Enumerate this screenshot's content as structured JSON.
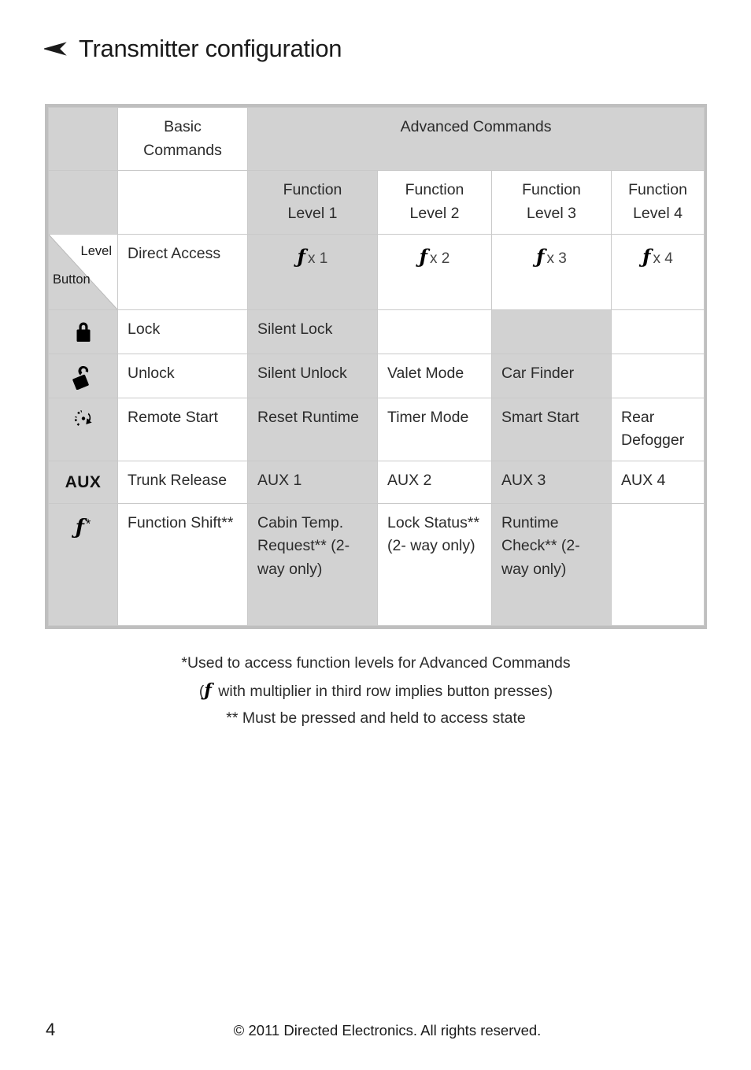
{
  "page": {
    "title": "Transmitter configuration",
    "bullet_icon": "arrow-bullet-icon"
  },
  "table": {
    "header": {
      "basic_commands": "Basic\nCommands",
      "basic_commands_line1": "Basic",
      "basic_commands_line2": "Commands",
      "advanced_commands": "Advanced Commands",
      "function_levels": [
        {
          "line1": "Function",
          "line2": "Level 1"
        },
        {
          "line1": "Function",
          "line2": "Level 2"
        },
        {
          "line1": "Function",
          "line2": "Level 3"
        },
        {
          "line1": "Function",
          "line2": "Level 4"
        }
      ],
      "corner": {
        "level_label": "Level",
        "button_label": "Button"
      },
      "direct_access": "Direct Access",
      "multipliers": [
        "x 1",
        "x 2",
        "x 3",
        "x 4"
      ],
      "f_symbol": "ƒ"
    },
    "rows": [
      {
        "icon": "lock-closed-icon",
        "icon_type": "svg",
        "basic": "Lock",
        "level1": "Silent Lock",
        "level2": "",
        "level3": "",
        "level4": ""
      },
      {
        "icon": "lock-open-icon",
        "icon_type": "svg",
        "basic": "Unlock",
        "level1": "Silent Unlock",
        "level2": "Valet Mode",
        "level3": "Car Finder",
        "level4": ""
      },
      {
        "icon": "remote-start-icon",
        "icon_type": "svg",
        "basic": "Remote Start",
        "level1": "Reset Runtime",
        "level2": "Timer Mode",
        "level3": "Smart Start",
        "level4": "Rear Defogger"
      },
      {
        "icon": "aux-text-icon",
        "icon_type": "text",
        "icon_text": "AUX",
        "basic": "Trunk Release",
        "level1": "AUX 1",
        "level2": "AUX 2",
        "level3": "AUX 3",
        "level4": "AUX 4"
      },
      {
        "icon": "function-shift-icon",
        "icon_type": "fstar",
        "basic": "Function Shift**",
        "level1": "Cabin Temp. Request** (2- way only)",
        "level2": "Lock Status** (2- way only)",
        "level3": "Runtime Check** (2- way only)",
        "level4": ""
      }
    ],
    "shading": {
      "gray_hex": "#d2d2d2",
      "border_hex": "#c9c9c9",
      "frame_hex": "#bfbfbf"
    }
  },
  "footnotes": {
    "line1": "*Used to access function levels for Advanced Commands",
    "line2_prefix": "(",
    "line2_symbol": "ƒ",
    "line2_suffix": " with multiplier in third row implies button presses)",
    "line3": "** Must be pressed and held to access state"
  },
  "footer": {
    "page_number": "4",
    "copyright": "© 2011 Directed Electronics. All rights reserved."
  }
}
